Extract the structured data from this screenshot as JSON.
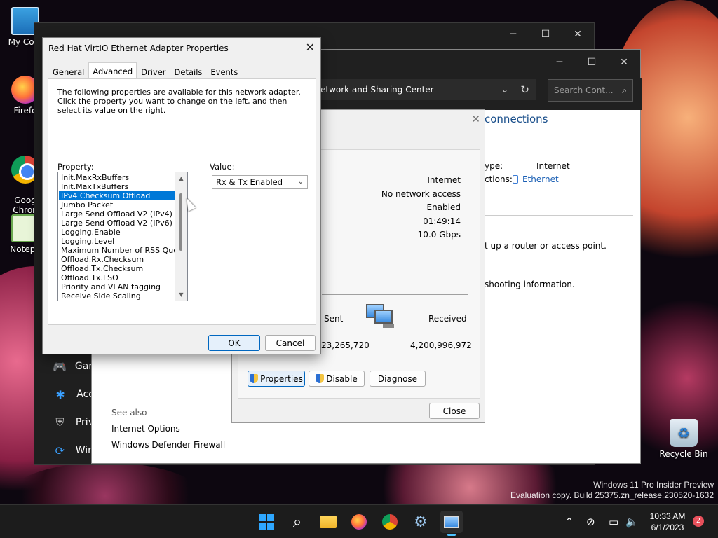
{
  "desktop": {
    "icons": [
      {
        "label": "My Com"
      },
      {
        "label": "Firefo"
      },
      {
        "label": "Goog\nChron"
      },
      {
        "label": "Notepa"
      }
    ],
    "recycle_bin": "Recycle Bin"
  },
  "settings_window": {
    "nav": [
      {
        "label": "Gan",
        "icon": "gamepad-icon"
      },
      {
        "label": "Acc",
        "icon": "accessibility-icon"
      },
      {
        "label": "Priv",
        "icon": "shield-icon"
      },
      {
        "label": "Win",
        "icon": "update-icon"
      }
    ]
  },
  "nsc_window": {
    "address": "etwork and Sharing Center",
    "search_placeholder": "Search Cont...",
    "heading": "connections",
    "type_label": "ype:",
    "type_value": "Internet",
    "connections_label": "ctions:",
    "connections_value": "Ethernet",
    "router_text": "t up a router or access point.",
    "troubleshoot_text": "shooting information.",
    "see_also": "See also",
    "links": [
      "Internet Options",
      "Windows Defender Firewall"
    ]
  },
  "status_dialog": {
    "values": [
      "Internet",
      "No network access",
      "Enabled",
      "01:49:14",
      "10.0 Gbps"
    ],
    "sent_label": "Sent",
    "received_label": "Received",
    "sent_value": "23,265,720",
    "received_value": "4,200,996,972",
    "buttons": {
      "properties": "Properties",
      "disable": "Disable",
      "diagnose": "Diagnose",
      "close": "Close"
    }
  },
  "props_dialog": {
    "title": "Red Hat VirtIO Ethernet Adapter Properties",
    "tabs": [
      "General",
      "Advanced",
      "Driver",
      "Details",
      "Events"
    ],
    "active_tab": "Advanced",
    "description": "The following properties are available for this network adapter. Click the property you want to change on the left, and then select its value on the right.",
    "property_label": "Property:",
    "value_label": "Value:",
    "properties": [
      "Init.MaxRxBuffers",
      "Init.MaxTxBuffers",
      "IPv4 Checksum Offload",
      "Jumbo Packet",
      "Large Send Offload V2 (IPv4)",
      "Large Send Offload V2 (IPv6)",
      "Logging.Enable",
      "Logging.Level",
      "Maximum Number of RSS Queues",
      "Offload.Rx.Checksum",
      "Offload.Tx.Checksum",
      "Offload.Tx.LSO",
      "Priority and VLAN tagging",
      "Receive Side Scaling"
    ],
    "selected_property": "IPv4 Checksum Offload",
    "value": "Rx & Tx Enabled",
    "ok": "OK",
    "cancel": "Cancel"
  },
  "watermark": {
    "line1": "Windows 11 Pro Insider Preview",
    "line2": "Evaluation copy. Build 25375.zn_release.230520-1632"
  },
  "taskbar": {
    "time": "10:33 AM",
    "date": "6/1/2023",
    "notification_count": "2"
  }
}
